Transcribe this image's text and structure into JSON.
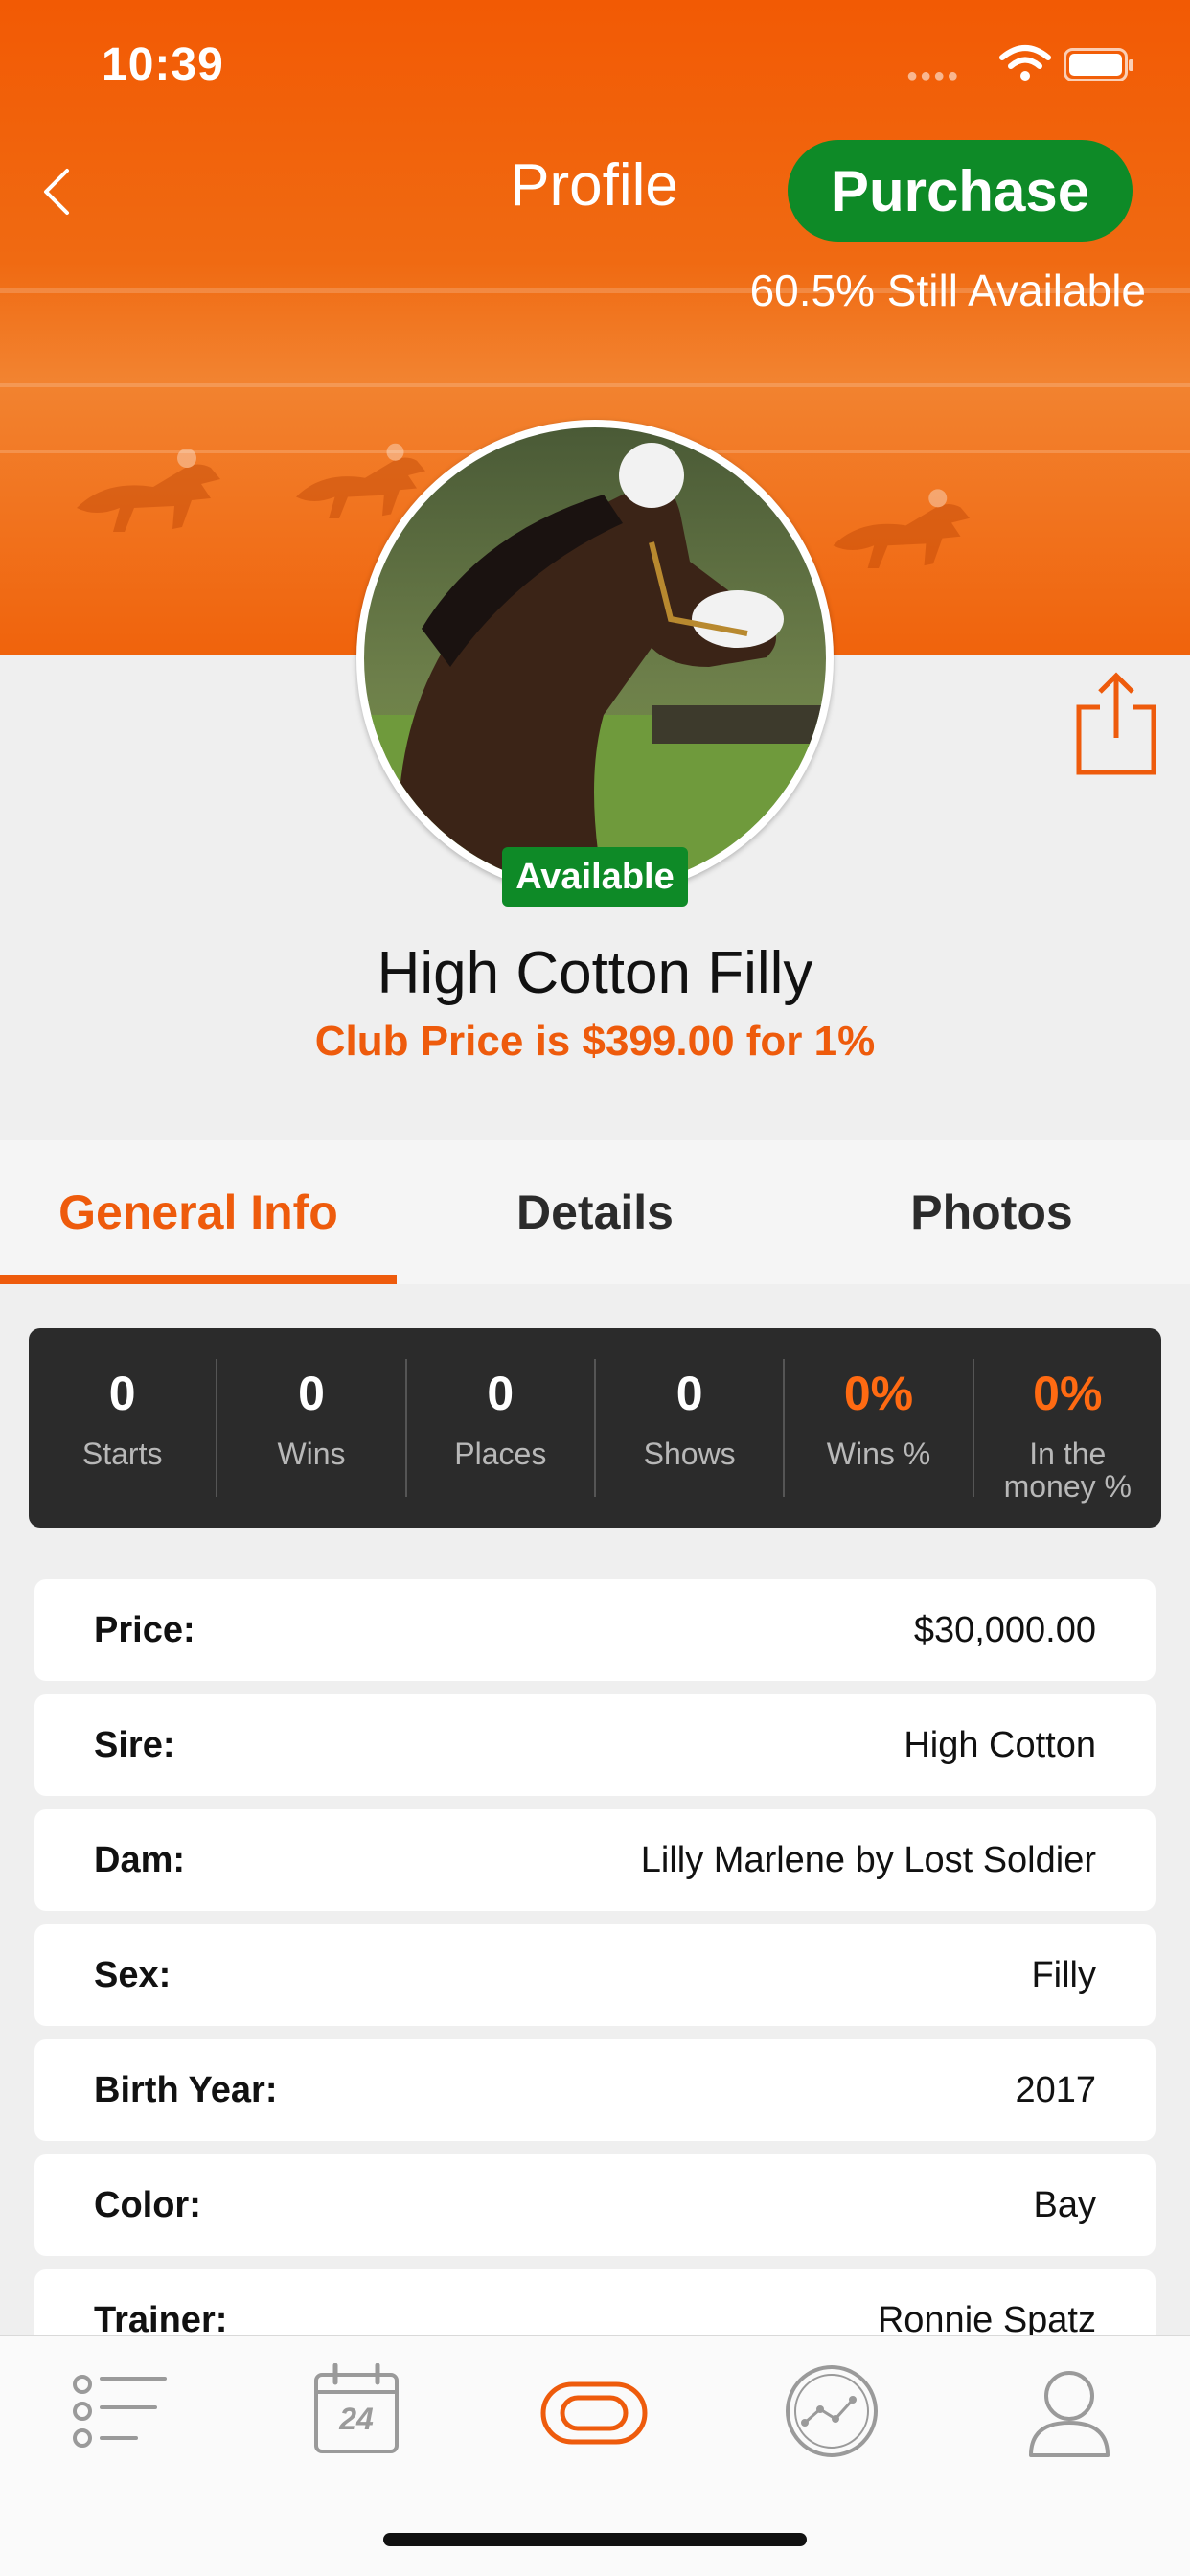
{
  "status_bar": {
    "time": "10:39"
  },
  "nav": {
    "title": "Profile",
    "purchase_label": "Purchase",
    "availability": "60.5% Still Available"
  },
  "horse": {
    "name": "High Cotton Filly",
    "status": "Available",
    "club_price": "Club Price is $399.00 for 1%"
  },
  "tabs": [
    {
      "label": "General Info",
      "active": true
    },
    {
      "label": "Details",
      "active": false
    },
    {
      "label": "Photos",
      "active": false
    }
  ],
  "stats": [
    {
      "value": "0",
      "label": "Starts"
    },
    {
      "value": "0",
      "label": "Wins"
    },
    {
      "value": "0",
      "label": "Places"
    },
    {
      "value": "0",
      "label": "Shows"
    },
    {
      "value": "0%",
      "label": "Wins %"
    },
    {
      "value": "0%",
      "label": "In the money %"
    }
  ],
  "info_rows": [
    {
      "label": "Price:",
      "value": "$30,000.00"
    },
    {
      "label": "Sire:",
      "value": "High Cotton"
    },
    {
      "label": "Dam:",
      "value": "Lilly Marlene by Lost Soldier"
    },
    {
      "label": "Sex:",
      "value": "Filly"
    },
    {
      "label": "Birth Year:",
      "value": "2017"
    },
    {
      "label": "Color:",
      "value": "Bay"
    },
    {
      "label": "Trainer:",
      "value": "Ronnie Spatz"
    }
  ],
  "tab_bar": {
    "calendar_day": "24",
    "items": [
      "list-icon",
      "calendar-icon",
      "racetrack-icon",
      "stats-icon",
      "profile-icon"
    ],
    "active": "racetrack-icon"
  },
  "colors": {
    "brand_orange": "#ee5b0c",
    "green": "#0e8a27",
    "stats_bg": "#2b2b2b"
  }
}
